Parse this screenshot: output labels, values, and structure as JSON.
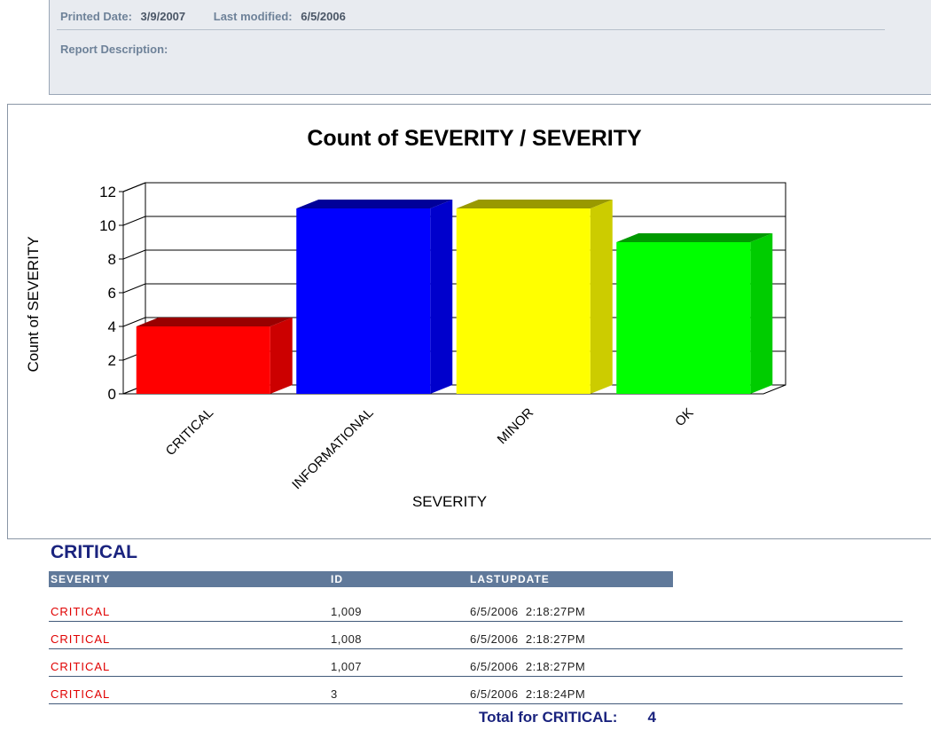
{
  "header": {
    "printed_label": "Printed Date:",
    "printed_value": "3/9/2007",
    "modified_label": "Last modified:",
    "modified_value": "6/5/2006",
    "description_label": "Report Description:"
  },
  "chart_data": {
    "type": "bar",
    "title": "Count of SEVERITY / SEVERITY",
    "xlabel": "SEVERITY",
    "ylabel": "Count of SEVERITY",
    "categories": [
      "CRITICAL",
      "INFORMATIONAL",
      "MINOR",
      "OK"
    ],
    "values": [
      4,
      11,
      11,
      9
    ],
    "ylim": [
      0,
      12
    ],
    "yticks": [
      0,
      2,
      4,
      6,
      8,
      10,
      12
    ],
    "colors": [
      "#ff0000",
      "#0000ff",
      "#ffff00",
      "#00ff00"
    ],
    "grid": true,
    "style": "3d"
  },
  "group": {
    "title": "CRITICAL",
    "columns": [
      "SEVERITY",
      "ID",
      "LASTUPDATE"
    ],
    "rows": [
      {
        "severity": "CRITICAL",
        "id": "1,009",
        "date": "6/5/2006",
        "time": "2:18:27PM"
      },
      {
        "severity": "CRITICAL",
        "id": "1,008",
        "date": "6/5/2006",
        "time": "2:18:27PM"
      },
      {
        "severity": "CRITICAL",
        "id": "1,007",
        "date": "6/5/2006",
        "time": "2:18:27PM"
      },
      {
        "severity": "CRITICAL",
        "id": "3",
        "date": "6/5/2006",
        "time": "2:18:24PM"
      }
    ],
    "total_label": "Total for CRITICAL:",
    "total_value": "4"
  }
}
